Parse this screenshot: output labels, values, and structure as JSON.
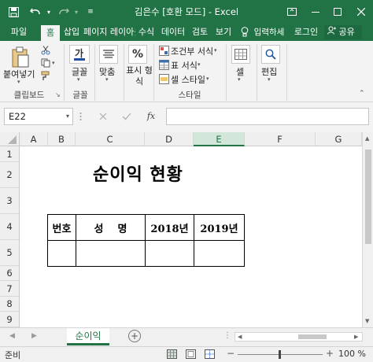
{
  "titlebar": {
    "title": "김은수  [호환 모드] - Excel",
    "accent": "#217346"
  },
  "quick_access": [
    {
      "icon": "save-icon",
      "glyph": "💾"
    },
    {
      "icon": "undo-icon",
      "glyph": "↶"
    },
    {
      "icon": "redo-icon",
      "glyph": "↷"
    },
    {
      "icon": "customize-icon",
      "glyph": "▾"
    }
  ],
  "tabs": [
    {
      "label": "파일"
    },
    {
      "label": "홈",
      "active": true
    },
    {
      "label": "삽입"
    },
    {
      "label": "페이지 레이아웃"
    },
    {
      "label": "수식"
    },
    {
      "label": "데이터"
    },
    {
      "label": "검토"
    },
    {
      "label": "보기"
    }
  ],
  "tell_me": "입력하세",
  "sign_in": "로그인",
  "share": "공유",
  "ribbon": {
    "paste_label": "붙여넣기",
    "clipboard_label": "클립보드",
    "font_label": "글꼴",
    "align_label": "맞춤",
    "number_label": "표시 형식",
    "number_icon": "%",
    "conditional_format": "조건부 서식",
    "format_as_table": "표 서식",
    "cell_styles": "셀 스타일",
    "styles_label": "스타일",
    "cells_label": "셀",
    "editing_label": "편집"
  },
  "formula_bar": {
    "name_box": "E22",
    "fx": "fx",
    "formula": ""
  },
  "columns": [
    "A",
    "B",
    "C",
    "D",
    "E",
    "F",
    "G"
  ],
  "selected_column": "E",
  "rows": [
    "1",
    "2",
    "3",
    "4",
    "5",
    "6",
    "7",
    "8",
    "9"
  ],
  "sheet": {
    "title": "순이익 현황",
    "table_headers": [
      "번호",
      "성    명",
      "2018년",
      "2019년"
    ],
    "table_row": [
      "",
      "",
      "",
      ""
    ]
  },
  "sheet_tabs": [
    "순이익"
  ],
  "status": {
    "ready": "준비",
    "zoom": "100 %"
  }
}
